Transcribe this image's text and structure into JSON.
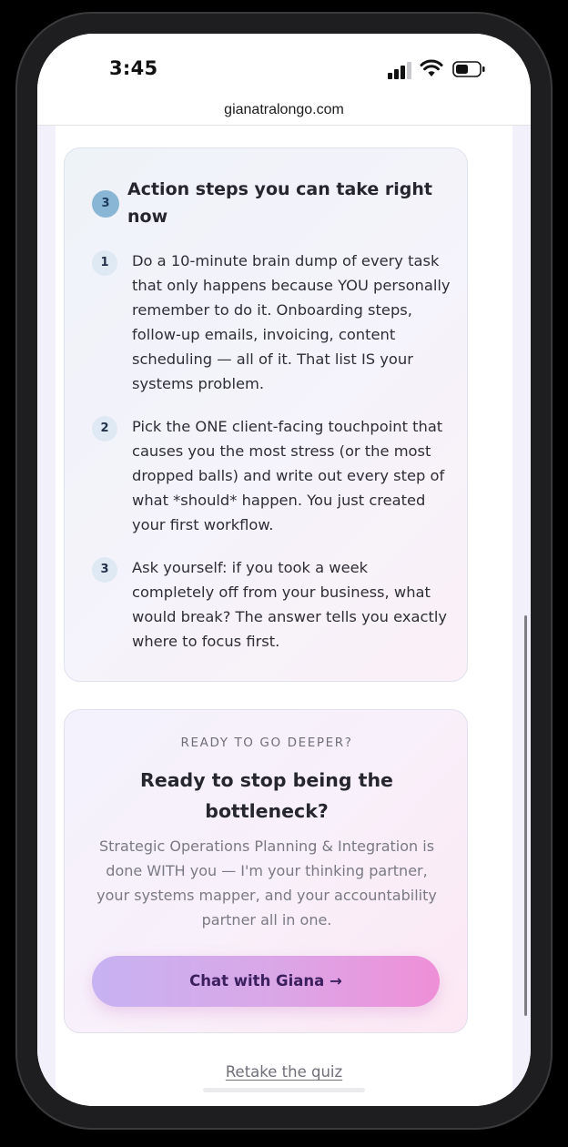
{
  "status_bar": {
    "time": "3:45",
    "icons": [
      "cellular-signal-icon",
      "wifi-icon",
      "battery-icon"
    ]
  },
  "browser": {
    "url": "gianatralongo.com"
  },
  "action_steps": {
    "badge": "3",
    "title": "Action steps you can take right now",
    "steps": [
      {
        "number": "1",
        "text": "Do a 10-minute brain dump of every task that only happens because YOU personally remember to do it. Onboarding steps, follow-up emails, invoicing, content scheduling — all of it. That list IS your systems problem."
      },
      {
        "number": "2",
        "text": "Pick the ONE client-facing touchpoint that causes you the most stress (or the most dropped balls) and write out every step of what *should* happen. You just created your first workflow."
      },
      {
        "number": "3",
        "text": "Ask yourself: if you took a week completely off from your business, what would break? The answer tells you exactly where to focus first."
      }
    ]
  },
  "cta": {
    "eyebrow": "READY TO GO DEEPER?",
    "title": "Ready to stop being the bottleneck?",
    "description": "Strategic Operations Planning & Integration is done WITH you — I'm your thinking partner, your systems mapper, and your accountability partner all in one.",
    "button_label": "Chat with Giana →"
  },
  "footer": {
    "retake_label": "Retake the quiz"
  },
  "colors": {
    "badge_blue": "#8ab6d6",
    "button_gradient_start": "#c7b2f2",
    "button_gradient_end": "#ef8fd8",
    "button_text": "#3b1f5e"
  }
}
